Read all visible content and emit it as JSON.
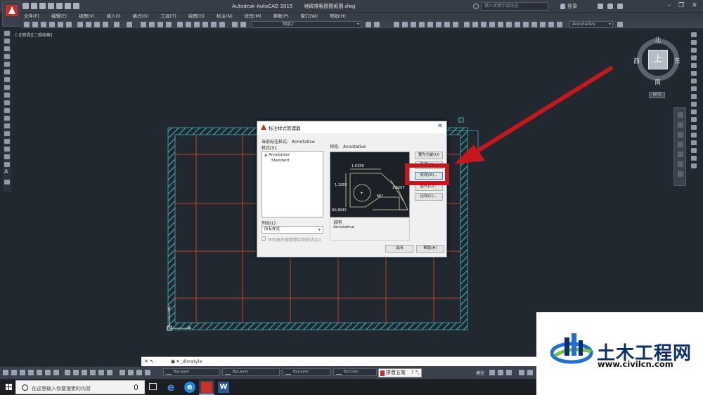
{
  "app": {
    "title": "Autodesk AutoCAD 2015",
    "filename": "地砖排板图图纸图.dwg",
    "search_placeholder": "键入关键字或短语",
    "login": "登录"
  },
  "menu": [
    "文件(F)",
    "编辑(E)",
    "视图(V)",
    "插入(I)",
    "格式(O)",
    "工具(T)",
    "绘图(D)",
    "标注(N)",
    "修改(M)",
    "参数(P)",
    "窗口(W)",
    "帮助(H)"
  ],
  "toolbar": {
    "layer_dropdown": "图层2",
    "annotative_dropdown": "Annotative"
  },
  "viewport": {
    "label": "[-][俯视][二维线框]"
  },
  "viewcube": {
    "north": "北",
    "south": "南",
    "east": "东",
    "west": "西",
    "top": "上",
    "wcs": "WCS"
  },
  "dialog": {
    "title": "标注样式管理器",
    "current_style_label": "当前标注样式:",
    "current_style_value": "Annotative",
    "styles_label": "样式(S):",
    "styles": [
      "Annotative",
      "Standard"
    ],
    "preview_label": "预览:",
    "preview_value": "Annotative",
    "list_label": "列出(L):",
    "list_value": "所有样式",
    "checkbox_label": "不列出外部参照中的样式(D)",
    "description_label": "说明",
    "description_value": "Annotative",
    "buttons": {
      "set_current": "置为当前(U)",
      "new": "新建(N)...",
      "modify": "修改(M)...",
      "override": "替代(O)...",
      "compare": "比较(C)...",
      "close": "关闭",
      "help": "帮助(H)"
    },
    "preview_dims": {
      "d1": "1.0159",
      "d2": "1.1955",
      "d3": "2.0207",
      "angle": "60°",
      "radius": "R0.8045"
    }
  },
  "command": {
    "controls": "✕ ↖",
    "prompt": "▣ ▾ _dimstyle"
  },
  "properties": {
    "color": "ByLayer",
    "linetype": "ByLayer",
    "lineweight": "ByLayer",
    "plotstyle": "ByColor",
    "ime": "拼音五笔",
    "model_tab": "模型"
  },
  "taskbar": {
    "search_placeholder": "在这里输入你要搜索的内容"
  },
  "watermark": {
    "text": "土木工程网",
    "url": "www.civilcn.com"
  },
  "colors": {
    "viewport_bg": "#212830",
    "grid_line": "#c0442c",
    "hatch": "#3fb3b8",
    "highlight": "#c8171c"
  }
}
